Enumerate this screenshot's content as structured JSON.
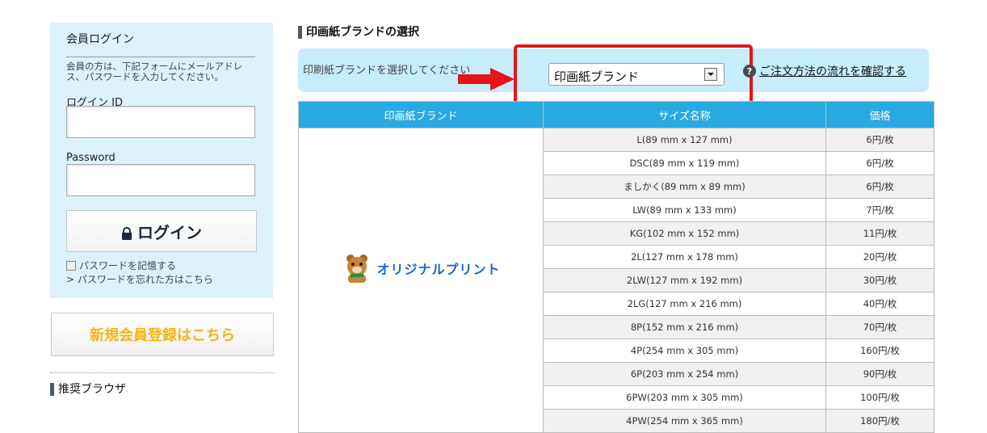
{
  "login": {
    "title": "会員ログイン",
    "description": "会員の方は、下記フォームにメールアドレス、パスワードを入力してください。",
    "id_label": "ログイン ID",
    "password_label": "Password",
    "button_label": "ログイン",
    "remember_label": "パスワードを記憶する",
    "forgot_label": "> パスワードを忘れた方はこちら"
  },
  "register": {
    "label": "新規会員登録はこちら"
  },
  "browser_section": {
    "title": "推奨ブラウザ"
  },
  "brand_section": {
    "title": "印画紙ブランドの選択",
    "prompt": "印刷紙ブランドを選択してください",
    "dropdown_value": "印画紙ブランド",
    "help_link": "ご注文方法の流れを確認する",
    "highlight_color": "#e5141b",
    "arrow_color": "#e5141b"
  },
  "table": {
    "headers": [
      "印画紙ブランド",
      "サイズ名称",
      "価格"
    ],
    "brand_logo_text": "オリジナルプリント",
    "rows": [
      {
        "size": "L(89 mm x 127 mm)",
        "price": "6円/枚"
      },
      {
        "size": "DSC(89 mm x 119 mm)",
        "price": "6円/枚"
      },
      {
        "size": "ましかく(89 mm x 89 mm)",
        "price": "6円/枚"
      },
      {
        "size": "LW(89 mm x 133 mm)",
        "price": "7円/枚"
      },
      {
        "size": "KG(102 mm x 152 mm)",
        "price": "11円/枚"
      },
      {
        "size": "2L(127 mm x 178 mm)",
        "price": "20円/枚"
      },
      {
        "size": "2LW(127 mm x 192 mm)",
        "price": "30円/枚"
      },
      {
        "size": "2LG(127 mm x 216 mm)",
        "price": "40円/枚"
      },
      {
        "size": "8P(152 mm x 216 mm)",
        "price": "70円/枚"
      },
      {
        "size": "4P(254 mm x 305 mm)",
        "price": "160円/枚"
      },
      {
        "size": "6P(203 mm x 254 mm)",
        "price": "90円/枚"
      },
      {
        "size": "6PW(203 mm x 305 mm)",
        "price": "100円/枚"
      },
      {
        "size": "4PW(254 mm x 365 mm)",
        "price": "180円/枚"
      }
    ]
  },
  "colors": {
    "header_blue": "#29a9e1",
    "panel_light_blue": "#ddf1fb",
    "register_yellow": "#f4b41a"
  }
}
